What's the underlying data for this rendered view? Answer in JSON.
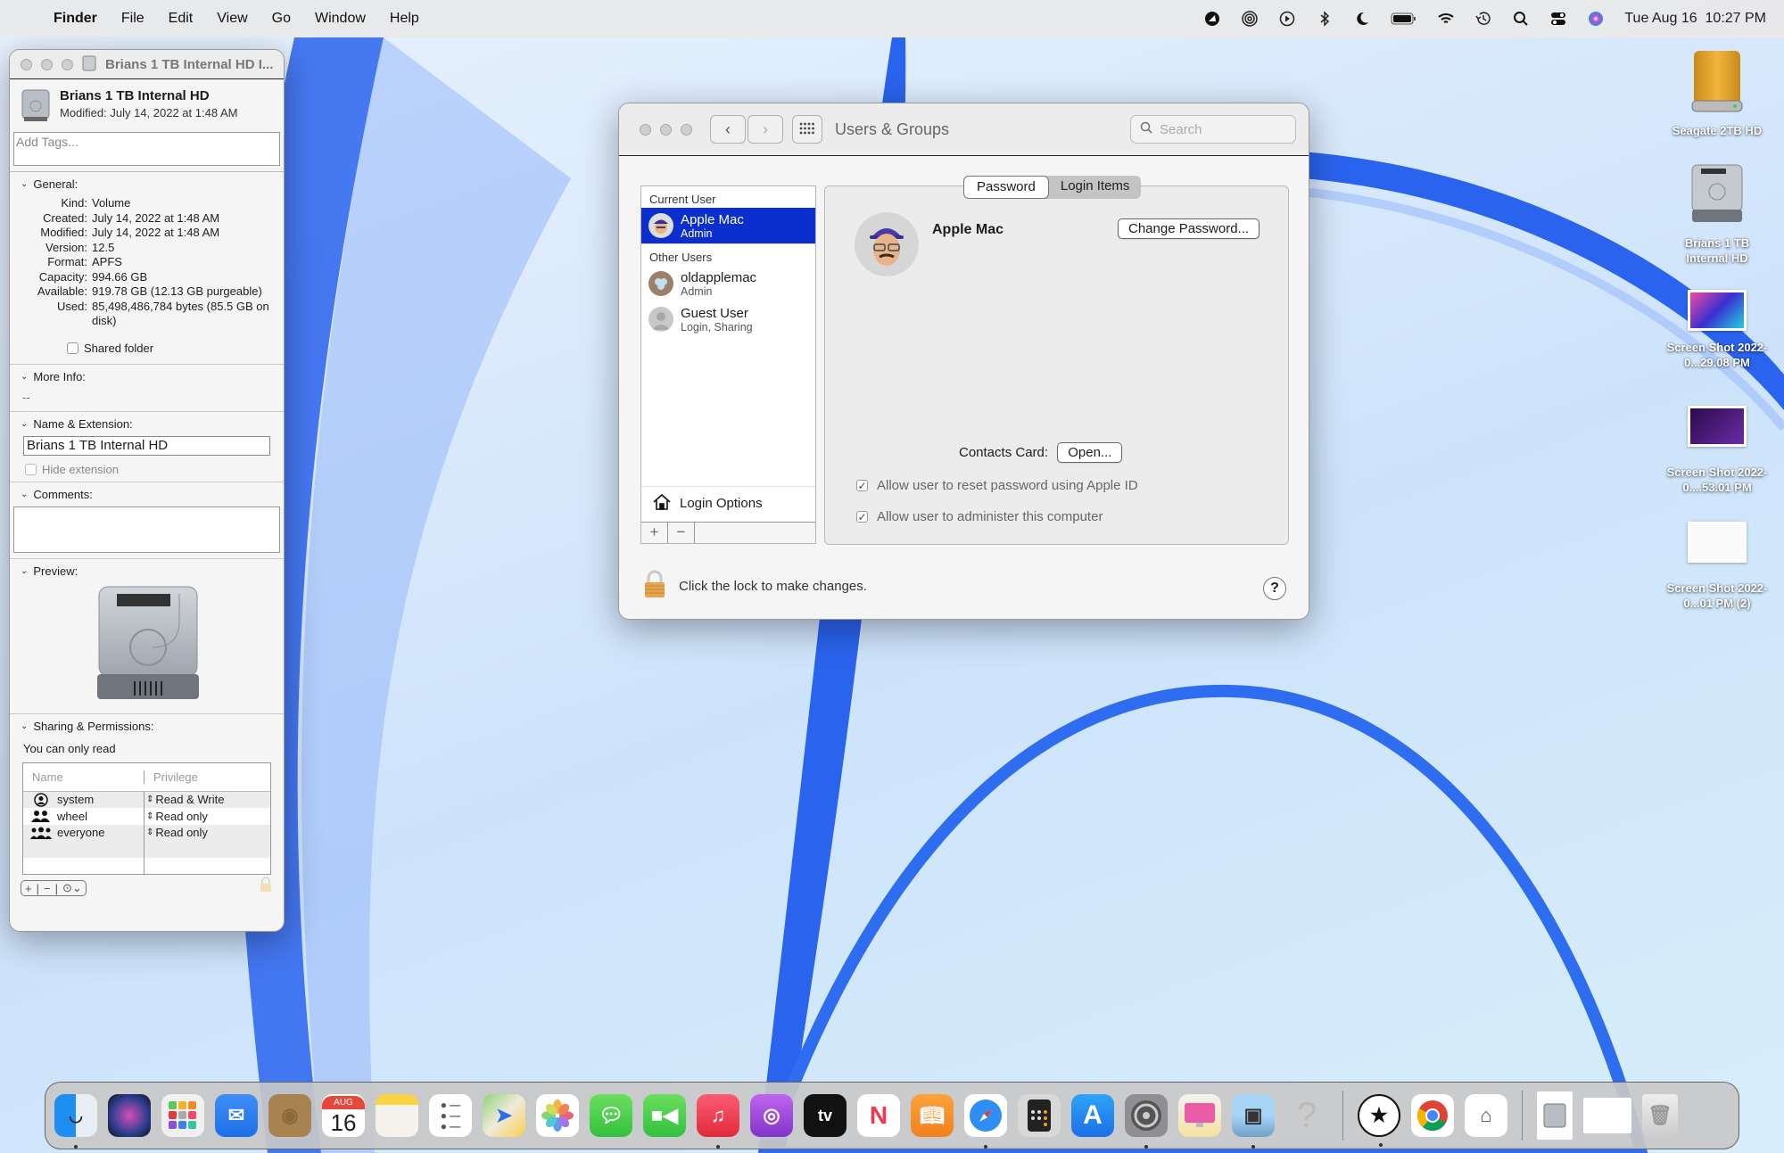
{
  "menubar": {
    "app_name": "Finder",
    "menus": [
      "File",
      "Edit",
      "View",
      "Go",
      "Window",
      "Help"
    ],
    "status_icons": [
      "creative-cloud-icon",
      "airdrop-icon",
      "now-playing-icon",
      "bluetooth-icon",
      "focus-moon-icon",
      "battery-icon",
      "wifi-icon",
      "time-machine-icon",
      "spotlight-search-icon",
      "control-center-icon",
      "siri-icon"
    ],
    "clock": "Tue Aug 16  10:27 PM"
  },
  "info_window": {
    "title": "Brians 1 TB Internal HD I...",
    "name": "Brians 1 TB Internal HD",
    "modified_header": "Modified: July 14, 2022 at 1:48 AM",
    "tags_placeholder": "Add Tags...",
    "general": {
      "label": "General:",
      "rows": [
        {
          "k": "Kind:",
          "v": "Volume"
        },
        {
          "k": "Created:",
          "v": "July 14, 2022 at 1:48 AM"
        },
        {
          "k": "Modified:",
          "v": "July 14, 2022 at 1:48 AM"
        },
        {
          "k": "Version:",
          "v": "12.5"
        },
        {
          "k": "Format:",
          "v": "APFS"
        },
        {
          "k": "Capacity:",
          "v": "994.66 GB"
        },
        {
          "k": "Available:",
          "v": "919.78 GB (12.13 GB purgeable)"
        },
        {
          "k": "Used:",
          "v": "85,498,486,784 bytes (85.5 GB on disk)"
        }
      ],
      "shared_folder_label": "Shared folder",
      "shared_folder_checked": false
    },
    "more_info": {
      "label": "More Info:",
      "value": "--"
    },
    "name_ext": {
      "label": "Name & Extension:",
      "value": "Brians 1 TB Internal HD",
      "hide_extension_label": "Hide extension",
      "hide_extension_checked": false
    },
    "comments": {
      "label": "Comments:",
      "value": ""
    },
    "preview": {
      "label": "Preview:"
    },
    "sharing": {
      "label": "Sharing & Permissions:",
      "status": "You can only read",
      "columns": [
        "Name",
        "Privilege"
      ],
      "rows": [
        {
          "name": "system",
          "privilege": "Read & Write",
          "icon": "user-circle-icon"
        },
        {
          "name": "wheel",
          "privilege": "Read only",
          "icon": "group-icon"
        },
        {
          "name": "everyone",
          "privilege": "Read only",
          "icon": "everyone-icon"
        }
      ],
      "add": "+",
      "remove": "−",
      "action": "⊙⌄"
    }
  },
  "users_groups": {
    "title": "Users & Groups",
    "search_placeholder": "Search",
    "current_user_header": "Current User",
    "other_users_header": "Other Users",
    "users": [
      {
        "name": "Apple Mac",
        "role": "Admin",
        "selected": true
      },
      {
        "name": "oldapplemac",
        "role": "Admin",
        "selected": false
      },
      {
        "name": "Guest User",
        "role": "Login, Sharing",
        "selected": false
      }
    ],
    "login_options": "Login Options",
    "add": "+",
    "remove": "−",
    "tabs": [
      {
        "label": "Password",
        "active": true
      },
      {
        "label": "Login Items",
        "active": false
      }
    ],
    "selected_name": "Apple Mac",
    "change_password": "Change Password...",
    "contacts_card_label": "Contacts Card:",
    "open_button": "Open...",
    "checkboxes": [
      {
        "label": "Allow user to reset password using Apple ID",
        "checked": true
      },
      {
        "label": "Allow user to administer this computer",
        "checked": true
      }
    ],
    "lock_text": "Click the lock to make changes.",
    "help": "?"
  },
  "desktop_icons": [
    {
      "label": "Seagate 2TB HD"
    },
    {
      "label": "Brians 1 TB Internal HD"
    },
    {
      "label": "Screen Shot 2022-0...29.08 PM"
    },
    {
      "label": "Screen Shot 2022-0....53.01 PM"
    },
    {
      "label": "Screen Shot 2022-0...01 PM (2)"
    }
  ],
  "dock": {
    "apps": [
      "Finder",
      "Siri",
      "Launchpad",
      "Mail",
      "Contacts",
      "Calendar",
      "Notes",
      "Reminders",
      "Maps",
      "Photos",
      "Messages",
      "FaceTime",
      "Music",
      "Podcasts",
      "TV",
      "News",
      "Books",
      "Safari",
      "Calculator",
      "App Store",
      "System Preferences",
      "CleanMyMac",
      "Preview",
      "Unknown App",
      "Bookmark App",
      "Google Chrome",
      "System Information",
      "Brians 1 TB Internal HD stack",
      "Downloads stack",
      "Trash"
    ],
    "calendar_month": "AUG",
    "calendar_day": "16",
    "tv_label": "tv"
  }
}
